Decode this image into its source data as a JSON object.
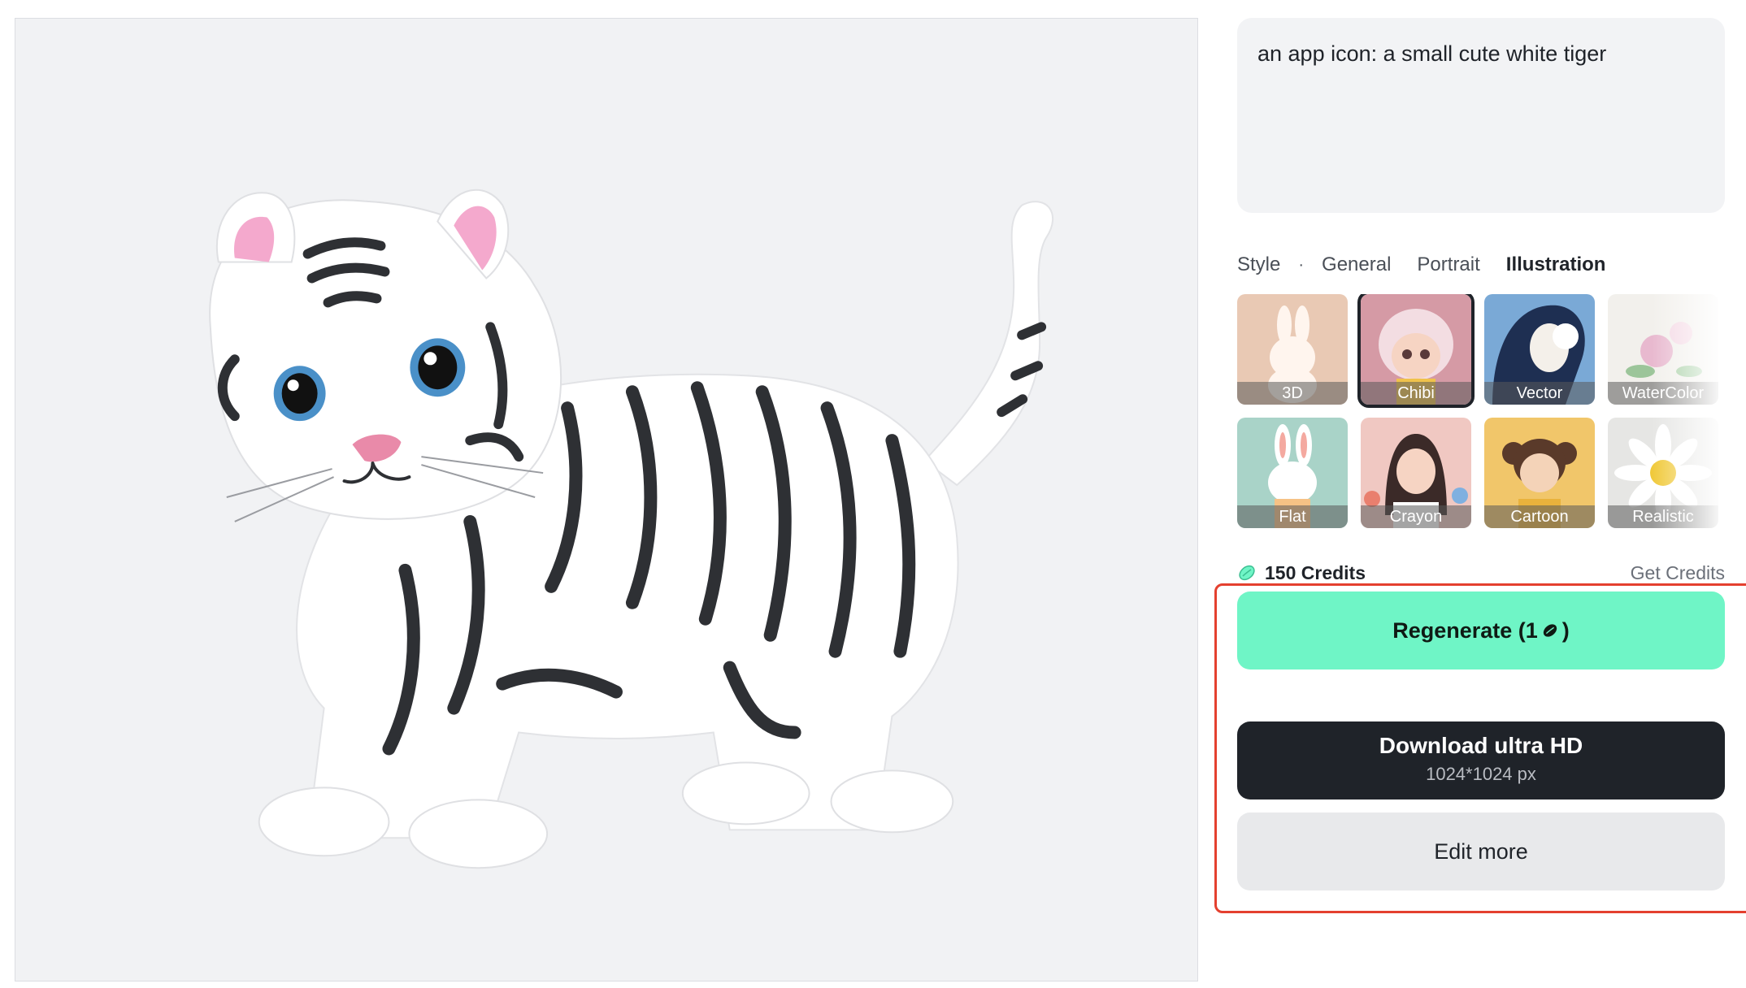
{
  "prompt": {
    "text": "an app icon: a small cute white tiger"
  },
  "style": {
    "label": "Style",
    "separator": "·",
    "tabs": [
      {
        "label": "General"
      },
      {
        "label": "Portrait"
      },
      {
        "label": "Illustration",
        "active": true
      }
    ],
    "options": [
      {
        "label": "3D"
      },
      {
        "label": "Chibi",
        "selected": true
      },
      {
        "label": "Vector"
      },
      {
        "label": "WaterColor"
      },
      {
        "label": "Flat"
      },
      {
        "label": "Crayon"
      },
      {
        "label": "Cartoon"
      },
      {
        "label": "Realistic"
      }
    ]
  },
  "credits": {
    "amount": "150 Credits",
    "get_label": "Get Credits"
  },
  "actions": {
    "regenerate_label": "Regenerate (1",
    "regenerate_suffix": ")",
    "download_label": "Download ultra HD",
    "download_size": "1024*1024 px",
    "edit_label": "Edit more"
  },
  "colors": {
    "accent": "#6ff5c6",
    "dark": "#1f2329",
    "highlight": "#e4402f"
  }
}
